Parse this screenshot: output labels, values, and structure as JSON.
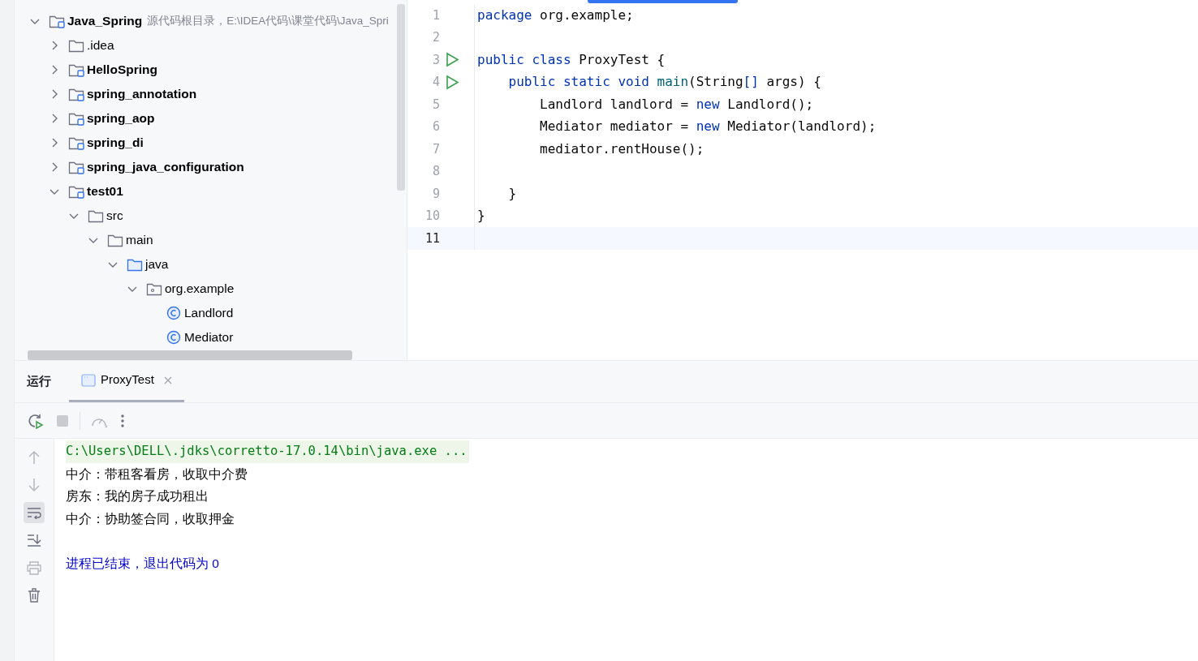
{
  "project_tree": [
    {
      "label": "Java_Spring",
      "hint": "源代码根目录，E:\\IDEA代码\\课堂代码\\Java_Spri",
      "kind": "module",
      "expanded": true,
      "children": [
        {
          "label": ".idea",
          "kind": "folder",
          "expanded": false
        },
        {
          "label": "HelloSpring",
          "kind": "module",
          "expanded": false
        },
        {
          "label": "spring_annotation",
          "kind": "module",
          "expanded": false
        },
        {
          "label": "spring_aop",
          "kind": "module",
          "expanded": false
        },
        {
          "label": "spring_di",
          "kind": "module",
          "expanded": false
        },
        {
          "label": "spring_java_configuration",
          "kind": "module",
          "expanded": false
        },
        {
          "label": "test01",
          "kind": "module",
          "expanded": true,
          "children": [
            {
              "label": "src",
              "kind": "folder",
              "expanded": true,
              "children": [
                {
                  "label": "main",
                  "kind": "folder",
                  "expanded": true,
                  "children": [
                    {
                      "label": "java",
                      "kind": "source-folder",
                      "expanded": true,
                      "children": [
                        {
                          "label": "org.example",
                          "kind": "package",
                          "expanded": true,
                          "children": [
                            {
                              "label": "Landlord",
                              "kind": "class"
                            },
                            {
                              "label": "Mediator",
                              "kind": "class"
                            }
                          ]
                        }
                      ]
                    }
                  ]
                }
              ]
            }
          ]
        }
      ]
    }
  ],
  "editor": {
    "lines": [
      {
        "number": "1",
        "run": false,
        "current": false,
        "tokens": [
          {
            "kind": "keyword",
            "text": "package"
          },
          {
            "kind": "plain",
            "text": " org.example;"
          }
        ]
      },
      {
        "number": "2",
        "run": false,
        "current": false
      },
      {
        "number": "3",
        "run": true,
        "current": false,
        "tokens": [
          {
            "kind": "keyword",
            "text": "public class"
          },
          {
            "kind": "plain",
            "text": " ProxyTest {"
          }
        ]
      },
      {
        "number": "4",
        "run": true,
        "current": false,
        "tokens": [
          {
            "kind": "keyword",
            "text": "    public static void"
          },
          {
            "kind": "method",
            "text": " main"
          },
          {
            "kind": "plain",
            "text": "(String"
          },
          {
            "kind": "keyword",
            "text": "[]"
          },
          {
            "kind": "plain",
            "text": " args) {"
          }
        ]
      },
      {
        "number": "5",
        "run": false,
        "current": false,
        "tokens": [
          {
            "kind": "plain",
            "text": "        Landlord landlord = "
          },
          {
            "kind": "keyword",
            "text": "new"
          },
          {
            "kind": "plain",
            "text": " Landlord();"
          }
        ]
      },
      {
        "number": "6",
        "run": false,
        "current": false,
        "tokens": [
          {
            "kind": "plain",
            "text": "        Mediator mediator = "
          },
          {
            "kind": "keyword",
            "text": "new"
          },
          {
            "kind": "plain",
            "text": " Mediator(landlord);"
          }
        ]
      },
      {
        "number": "7",
        "run": false,
        "current": false,
        "tokens": [
          {
            "kind": "plain",
            "text": "        mediator.rentHouse();"
          }
        ]
      },
      {
        "number": "8",
        "run": false,
        "current": false
      },
      {
        "number": "9",
        "run": false,
        "current": false,
        "tokens": [
          {
            "kind": "plain",
            "text": "    }"
          }
        ]
      },
      {
        "number": "10",
        "run": false,
        "current": false,
        "tokens": [
          {
            "kind": "plain",
            "text": "}"
          }
        ]
      },
      {
        "number": "11",
        "run": false,
        "current": true
      }
    ]
  },
  "run_panel": {
    "title": "运行",
    "tabs": [
      {
        "label": "ProxyTest",
        "selected": true
      }
    ],
    "console": [
      {
        "kind": "command",
        "text": "C:\\Users\\DELL\\.jdks\\corretto-17.0.14\\bin\\java.exe ..."
      },
      {
        "kind": "output",
        "text": "中介：带租客看房，收取中介费"
      },
      {
        "kind": "output",
        "text": "房东：我的房子成功租出"
      },
      {
        "kind": "output",
        "text": "中介：协助签合同，收取押金"
      },
      {
        "kind": "exit",
        "text": "进程已结束，退出代码为 0"
      }
    ]
  }
}
